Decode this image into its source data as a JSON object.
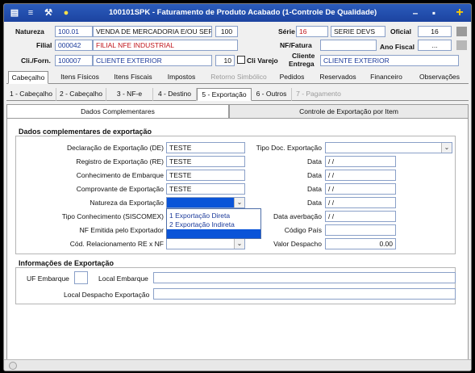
{
  "window": {
    "title": "100101SPK - Faturamento de Produto Acabado (1-Controle De Qualidade)"
  },
  "header": {
    "natureza_label": "Natureza",
    "natureza_code": "100.01",
    "natureza_desc": "VENDA DE MERCADORIA E/OU SERVI",
    "natureza_num": "100",
    "serie_label": "Série",
    "serie_value": "16",
    "serie_desc": "SERIE DEVS",
    "oficial_label": "Oficial",
    "oficial_value": "16",
    "filial_label": "Filial",
    "filial_code": "000042",
    "filial_desc": "FILIAL NFE INDUSTRIAL",
    "nf_fatura_label": "NF/Fatura",
    "ano_fiscal_label": "Ano Fiscal",
    "ano_fiscal_value": "...",
    "cli_label": "Cli./Forn.",
    "cli_code": "100007",
    "cli_desc": "CLIENTE EXTERIOR",
    "cli_num": "10",
    "cli_varejo_label": "Cli Varejo",
    "cliente_entrega_label1": "Cliente",
    "cliente_entrega_label2": "Entrega",
    "cliente_entrega_value": "CLIENTE EXTERIOR"
  },
  "tabs_main": [
    {
      "label": "Cabeçalho",
      "active": true,
      "disabled": false
    },
    {
      "label": "Itens Físicos",
      "active": false,
      "disabled": false
    },
    {
      "label": "Itens Fiscais",
      "active": false,
      "disabled": false
    },
    {
      "label": "Impostos",
      "active": false,
      "disabled": false
    },
    {
      "label": "Retorno Simbólico",
      "active": false,
      "disabled": true
    },
    {
      "label": "Pedidos",
      "active": false,
      "disabled": false
    },
    {
      "label": "Reservados",
      "active": false,
      "disabled": false
    },
    {
      "label": "Financeiro",
      "active": false,
      "disabled": false
    },
    {
      "label": "Observações",
      "active": false,
      "disabled": false
    }
  ],
  "tabs_sub": [
    {
      "label": "1 - Cabeçalho",
      "active": false,
      "disabled": false
    },
    {
      "label": "2 - Cabeçalho",
      "active": false,
      "disabled": false
    },
    {
      "label": "3 - NF-e",
      "active": false,
      "disabled": false
    },
    {
      "label": "4 - Destino",
      "active": false,
      "disabled": false
    },
    {
      "label": "5 - Exportação",
      "active": true,
      "disabled": false
    },
    {
      "label": "6 - Outros",
      "active": false,
      "disabled": false
    },
    {
      "label": "7 - Pagamento",
      "active": false,
      "disabled": true
    }
  ],
  "tabs_export": [
    {
      "label": "Dados Complementares",
      "active": true
    },
    {
      "label": "Controle de Exportação por Item",
      "active": false
    }
  ],
  "dados": {
    "section_title": "Dados complementares de exportação",
    "declaracao_label": "Declaração de Exportação (DE)",
    "declaracao_value": "TESTE",
    "registro_label": "Registro de Exportação (RE)",
    "registro_value": "TESTE",
    "conhecimento_label": "Conhecimento de Embarque",
    "conhecimento_value": "TESTE",
    "comprovante_label": "Comprovante de Exportação",
    "comprovante_value": "TESTE",
    "natureza_exp_label": "Natureza da Exportação",
    "tipo_conhecimento_label": "Tipo Conhecimento (SISCOMEX)",
    "nf_emitida_label": "NF Emitida pelo Exportador",
    "cod_relacionamento_label": "Cód. Relacionamento RE x NF",
    "tipo_doc_label": "Tipo Doc. Exportação",
    "data_label": "Data",
    "data_value": "/ /",
    "data_averbacao_label": "Data averbação",
    "codigo_pais_label": "Código País",
    "valor_despacho_label": "Valor Despacho",
    "valor_despacho_value": "0.00",
    "dropdown_options": [
      "1   Exportação Direta",
      "2   Exportação Indireta"
    ]
  },
  "info": {
    "section_title": "Informações de Exportação",
    "uf_embarque_label": "UF Embarque",
    "local_embarque_label": "Local Embarque",
    "local_despacho_label": "Local Despacho Exportação"
  }
}
